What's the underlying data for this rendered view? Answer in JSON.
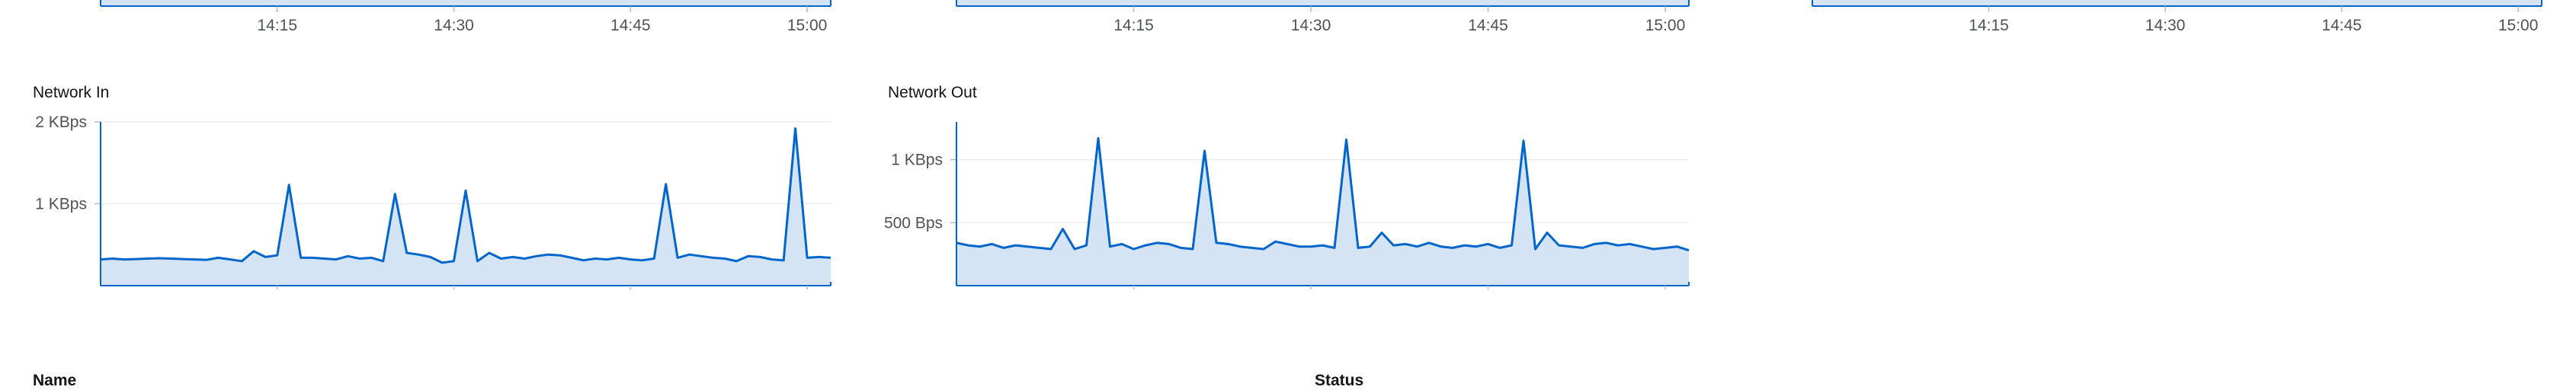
{
  "theme": {
    "line": "#0066cc",
    "fill": "#d5e4f5",
    "axis": "#0066cc",
    "grid": "#ececec",
    "tick_text": "#4f5255"
  },
  "charts": [
    {
      "id": "top-left-partial",
      "title": "",
      "x_ticks": [
        "14:15",
        "14:30",
        "14:45",
        "15:00"
      ],
      "y_ticks": [],
      "chart_data": {
        "type": "area",
        "series": [],
        "xlabel": "",
        "ylabel": ""
      }
    },
    {
      "id": "top-middle-partial",
      "title": "",
      "x_ticks": [
        "14:15",
        "14:30",
        "14:45",
        "15:00"
      ],
      "y_ticks": [],
      "chart_data": {
        "type": "area",
        "series": [],
        "xlabel": "",
        "ylabel": ""
      }
    },
    {
      "id": "top-right-partial",
      "title": "",
      "x_ticks": [
        "14:15",
        "14:30",
        "14:45",
        "15:00"
      ],
      "y_ticks": [],
      "chart_data": {
        "type": "area",
        "series": [],
        "xlabel": "",
        "ylabel": ""
      }
    },
    {
      "id": "network-in",
      "title": "Network In",
      "x_ticks": [
        "14:15",
        "14:30",
        "14:45",
        "15:00"
      ],
      "y_ticks": [
        {
          "label": "2 KBps",
          "value": 2000
        },
        {
          "label": "1 KBps",
          "value": 1000
        }
      ],
      "chart_data": {
        "type": "area",
        "title": "Network In",
        "xlabel": "",
        "ylabel": "",
        "ylim": [
          0,
          2000
        ],
        "xlim": [
          "14:00",
          "15:02"
        ],
        "x": [
          "14:00",
          "14:01",
          "14:02",
          "14:03",
          "14:04",
          "14:05",
          "14:06",
          "14:07",
          "14:08",
          "14:09",
          "14:10",
          "14:11",
          "14:12",
          "14:13",
          "14:14",
          "14:15",
          "14:16",
          "14:17",
          "14:18",
          "14:19",
          "14:20",
          "14:21",
          "14:22",
          "14:23",
          "14:24",
          "14:25",
          "14:26",
          "14:27",
          "14:28",
          "14:29",
          "14:30",
          "14:31",
          "14:32",
          "14:33",
          "14:34",
          "14:35",
          "14:36",
          "14:37",
          "14:38",
          "14:39",
          "14:40",
          "14:41",
          "14:42",
          "14:43",
          "14:44",
          "14:45",
          "14:46",
          "14:47",
          "14:48",
          "14:49",
          "14:50",
          "14:51",
          "14:52",
          "14:53",
          "14:54",
          "14:55",
          "14:56",
          "14:57",
          "14:58",
          "14:59",
          "15:00",
          "15:01",
          "15:02"
        ],
        "values": [
          320,
          330,
          320,
          325,
          330,
          335,
          330,
          325,
          320,
          315,
          340,
          320,
          300,
          420,
          350,
          370,
          1230,
          340,
          340,
          330,
          320,
          360,
          330,
          340,
          300,
          1120,
          400,
          380,
          350,
          280,
          300,
          1160,
          300,
          400,
          330,
          350,
          330,
          360,
          380,
          370,
          340,
          310,
          330,
          320,
          340,
          320,
          310,
          330,
          1240,
          340,
          380,
          360,
          340,
          330,
          300,
          360,
          350,
          320,
          310,
          1920,
          340,
          350,
          340
        ]
      }
    },
    {
      "id": "network-out",
      "title": "Network Out",
      "x_ticks": [
        "14:15",
        "14:30",
        "14:45",
        "15:00"
      ],
      "y_ticks": [
        {
          "label": "1 KBps",
          "value": 1000
        },
        {
          "label": "500 Bps",
          "value": 500
        }
      ],
      "chart_data": {
        "type": "area",
        "title": "Network Out",
        "xlabel": "",
        "ylabel": "",
        "ylim": [
          0,
          1300
        ],
        "xlim": [
          "14:00",
          "15:02"
        ],
        "x": [
          "14:00",
          "14:01",
          "14:02",
          "14:03",
          "14:04",
          "14:05",
          "14:06",
          "14:07",
          "14:08",
          "14:09",
          "14:10",
          "14:11",
          "14:12",
          "14:13",
          "14:14",
          "14:15",
          "14:16",
          "14:17",
          "14:18",
          "14:19",
          "14:20",
          "14:21",
          "14:22",
          "14:23",
          "14:24",
          "14:25",
          "14:26",
          "14:27",
          "14:28",
          "14:29",
          "14:30",
          "14:31",
          "14:32",
          "14:33",
          "14:34",
          "14:35",
          "14:36",
          "14:37",
          "14:38",
          "14:39",
          "14:40",
          "14:41",
          "14:42",
          "14:43",
          "14:44",
          "14:45",
          "14:46",
          "14:47",
          "14:48",
          "14:49",
          "14:50",
          "14:51",
          "14:52",
          "14:53",
          "14:54",
          "14:55",
          "14:56",
          "14:57",
          "14:58",
          "14:59",
          "15:00",
          "15:01",
          "15:02"
        ],
        "values": [
          340,
          320,
          310,
          330,
          300,
          320,
          310,
          300,
          290,
          450,
          290,
          320,
          1170,
          310,
          330,
          290,
          320,
          340,
          330,
          300,
          290,
          1070,
          340,
          330,
          310,
          300,
          290,
          350,
          330,
          310,
          310,
          320,
          300,
          1160,
          300,
          310,
          420,
          320,
          330,
          310,
          340,
          310,
          300,
          320,
          310,
          330,
          300,
          320,
          1150,
          290,
          420,
          320,
          310,
          300,
          330,
          340,
          320,
          330,
          310,
          290,
          300,
          310,
          280
        ]
      }
    }
  ],
  "sections": {
    "name_label": "Name",
    "status_label": "Status"
  }
}
